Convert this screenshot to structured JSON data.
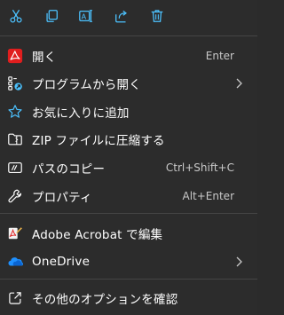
{
  "toolbar": {
    "buttons": [
      {
        "icon": "cut-icon"
      },
      {
        "icon": "copy-icon"
      },
      {
        "icon": "rename-icon"
      },
      {
        "icon": "share-icon"
      },
      {
        "icon": "delete-icon"
      }
    ]
  },
  "items": [
    {
      "icon": "acrobat-icon",
      "label": "開く",
      "shortcut": "Enter"
    },
    {
      "icon": "open-with-icon",
      "label": "プログラムから開く",
      "submenu": true
    },
    {
      "icon": "star-icon",
      "label": "お気に入りに追加"
    },
    {
      "icon": "zip-folder-icon",
      "label": "ZIP ファイルに圧縮する"
    },
    {
      "icon": "copy-path-icon",
      "label": "パスのコピー",
      "shortcut": "Ctrl+Shift+C"
    },
    {
      "icon": "wrench-icon",
      "label": "プロパティ",
      "shortcut": "Alt+Enter"
    },
    {
      "icon": "acrobat-edit-icon",
      "label": "Adobe Acrobat で編集"
    },
    {
      "icon": "onedrive-icon",
      "label": "OneDrive",
      "submenu": true
    },
    {
      "icon": "more-options-icon",
      "label": "その他のオプションを確認"
    }
  ],
  "colors": {
    "background": "#2c2c2c",
    "separator": "#454545",
    "accent_blue": "#4cc2ff",
    "acrobat_red": "#e01e1e",
    "onedrive_blue": "#1e90ff"
  }
}
